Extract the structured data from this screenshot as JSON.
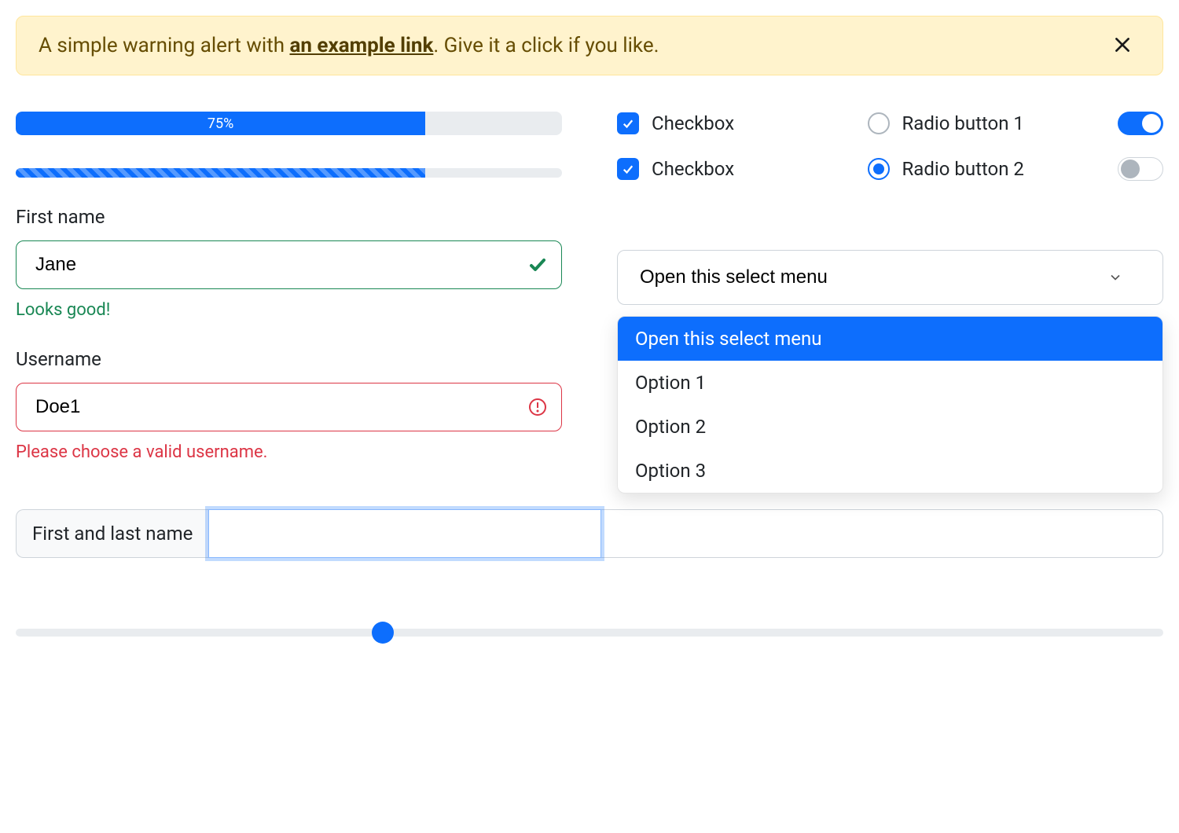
{
  "alert": {
    "text_before": "A simple warning alert with ",
    "link_text": "an example link",
    "text_after": ". Give it a click if you like."
  },
  "progress": {
    "main_percent": 75,
    "main_label": "75%",
    "striped_percent": 75
  },
  "form": {
    "first_name": {
      "label": "First name",
      "value": "Jane",
      "feedback": "Looks good!"
    },
    "username": {
      "label": "Username",
      "value": "Doe1",
      "feedback": "Please choose a valid username."
    }
  },
  "controls": {
    "checkbox1_label": "Checkbox",
    "checkbox2_label": "Checkbox",
    "radio1_label": "Radio button 1",
    "radio2_label": "Radio button 2",
    "checkbox1_checked": true,
    "checkbox2_checked": true,
    "radio_selected": 2,
    "switch1_on": true,
    "switch2_on": false
  },
  "select": {
    "placeholder": "Open this select menu",
    "options": [
      "Open this select menu",
      "Option 1",
      "Option 2",
      "Option 3"
    ],
    "active_index": 0
  },
  "input_group": {
    "label": "First and last name",
    "value": ""
  },
  "range": {
    "value": 32,
    "min": 0,
    "max": 100
  }
}
